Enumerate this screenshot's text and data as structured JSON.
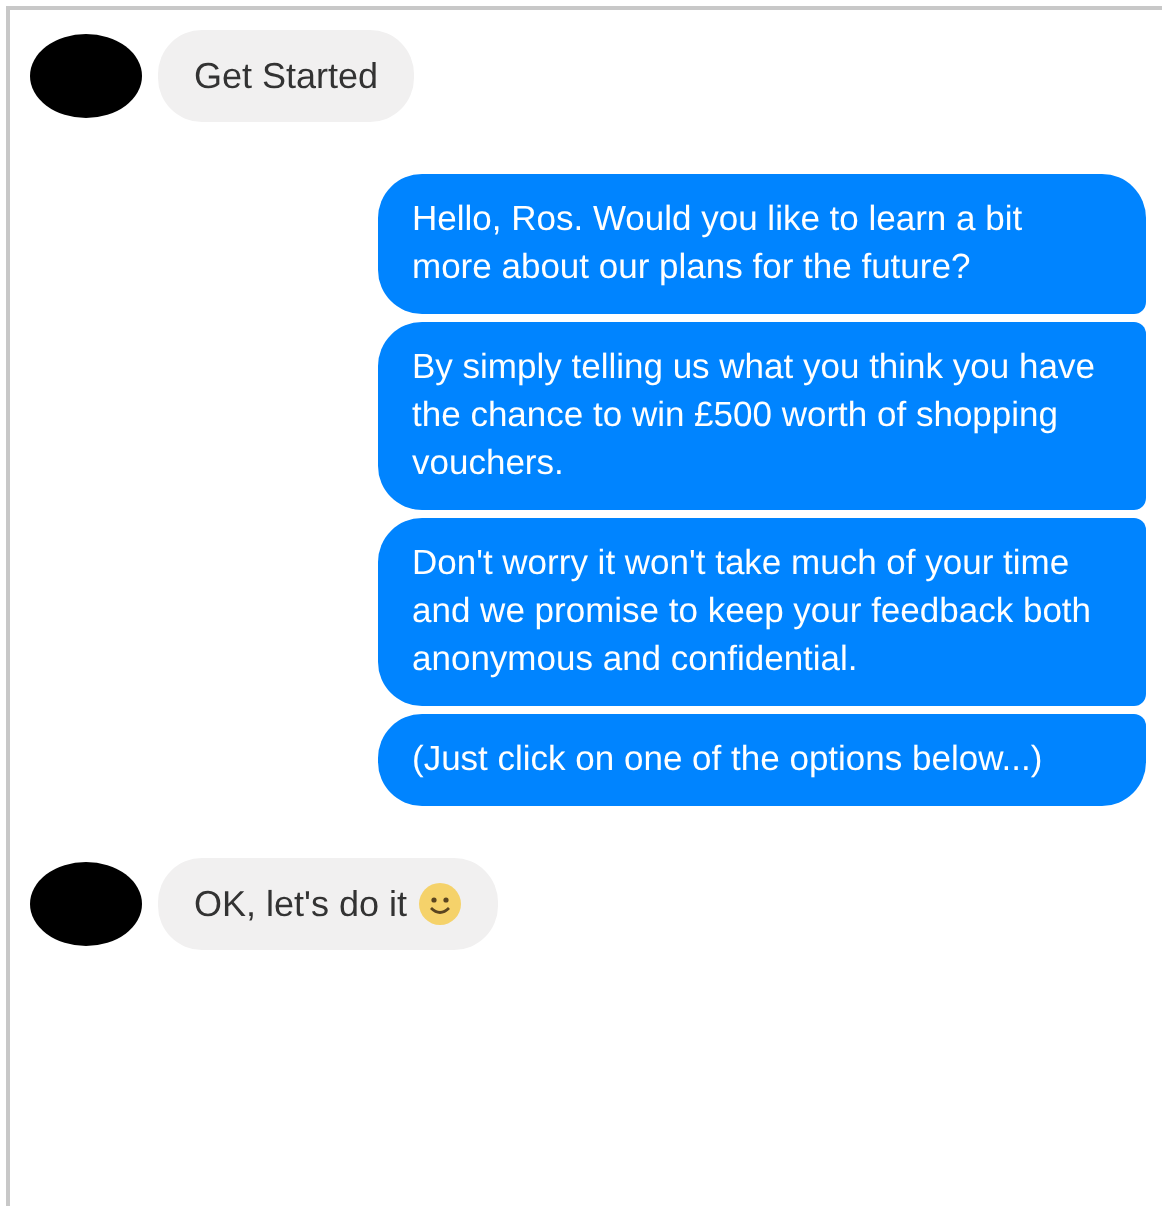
{
  "messages": [
    {
      "kind": "incoming",
      "text": "Get Started",
      "emoji": false
    },
    {
      "kind": "outgoing",
      "text": "Hello, Ros.  Would you like to learn a bit more about our plans for the future?"
    },
    {
      "kind": "outgoing",
      "text": "By simply telling us what you think you have the chance to win £500 worth of shopping vouchers."
    },
    {
      "kind": "outgoing",
      "text": "Don't worry it won't take much of your time and we promise to keep your feedback both anonymous and confidential."
    },
    {
      "kind": "outgoing",
      "text": "(Just click on one of the options below...)"
    },
    {
      "kind": "incoming",
      "text": "OK, let's do it",
      "emoji": true
    }
  ]
}
